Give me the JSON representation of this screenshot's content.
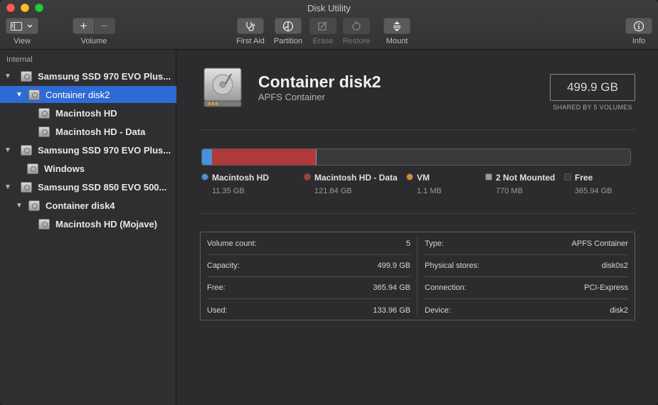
{
  "window": {
    "title": "Disk Utility"
  },
  "toolbar": {
    "view_label": "View",
    "volume_label": "Volume",
    "add_symbol": "+",
    "remove_symbol": "−",
    "first_aid_label": "First Aid",
    "partition_label": "Partition",
    "erase_label": "Erase",
    "restore_label": "Restore",
    "mount_label": "Mount",
    "info_label": "Info"
  },
  "sidebar": {
    "section": "Internal",
    "items": [
      {
        "label": "Samsung SSD 970 EVO Plus...",
        "expanded": true,
        "selected": false
      },
      {
        "label": "Container disk2",
        "expanded": true,
        "selected": true
      },
      {
        "label": "Macintosh HD",
        "selected": false
      },
      {
        "label": "Macintosh HD - Data",
        "selected": false
      },
      {
        "label": "Samsung SSD 970 EVO Plus...",
        "expanded": true,
        "selected": false
      },
      {
        "label": "Windows",
        "selected": false
      },
      {
        "label": "Samsung SSD 850 EVO 500...",
        "expanded": true,
        "selected": false
      },
      {
        "label": "Container disk4",
        "expanded": true,
        "selected": false
      },
      {
        "label": "Macintosh HD (Mojave)",
        "selected": false
      }
    ]
  },
  "detail": {
    "title": "Container disk2",
    "subtitle": "APFS Container",
    "capacity": "499.9 GB",
    "shared_by": "SHARED BY 5 VOLUMES"
  },
  "usage": {
    "volumes": [
      {
        "name": "Macintosh HD",
        "size": "11.35 GB",
        "gb": 11.35,
        "color": "#4a90d9",
        "shape": "circle"
      },
      {
        "name": "Macintosh HD - Data",
        "size": "121.84 GB",
        "gb": 121.84,
        "color": "#b03a3a",
        "shape": "circle"
      },
      {
        "name": "VM",
        "size": "1.1 MB",
        "gb": 0.0011,
        "color": "#d98a2a",
        "shape": "circle"
      },
      {
        "name": "2 Not Mounted",
        "size": "770 MB",
        "gb": 0.77,
        "color": "#9a9a9a",
        "shape": "square"
      },
      {
        "name": "Free",
        "size": "365.94 GB",
        "gb": 365.94,
        "color": "#3a3a3c",
        "shape": "square"
      }
    ],
    "total_gb": 499.9
  },
  "info": {
    "left": [
      {
        "label": "Volume count:",
        "value": "5"
      },
      {
        "label": "Capacity:",
        "value": "499.9 GB"
      },
      {
        "label": "Free:",
        "value": "365.94 GB"
      },
      {
        "label": "Used:",
        "value": "133.96 GB"
      }
    ],
    "right": [
      {
        "label": "Type:",
        "value": "APFS Container"
      },
      {
        "label": "Physical stores:",
        "value": "disk0s2"
      },
      {
        "label": "Connection:",
        "value": "PCI-Express"
      },
      {
        "label": "Device:",
        "value": "disk2"
      }
    ]
  }
}
